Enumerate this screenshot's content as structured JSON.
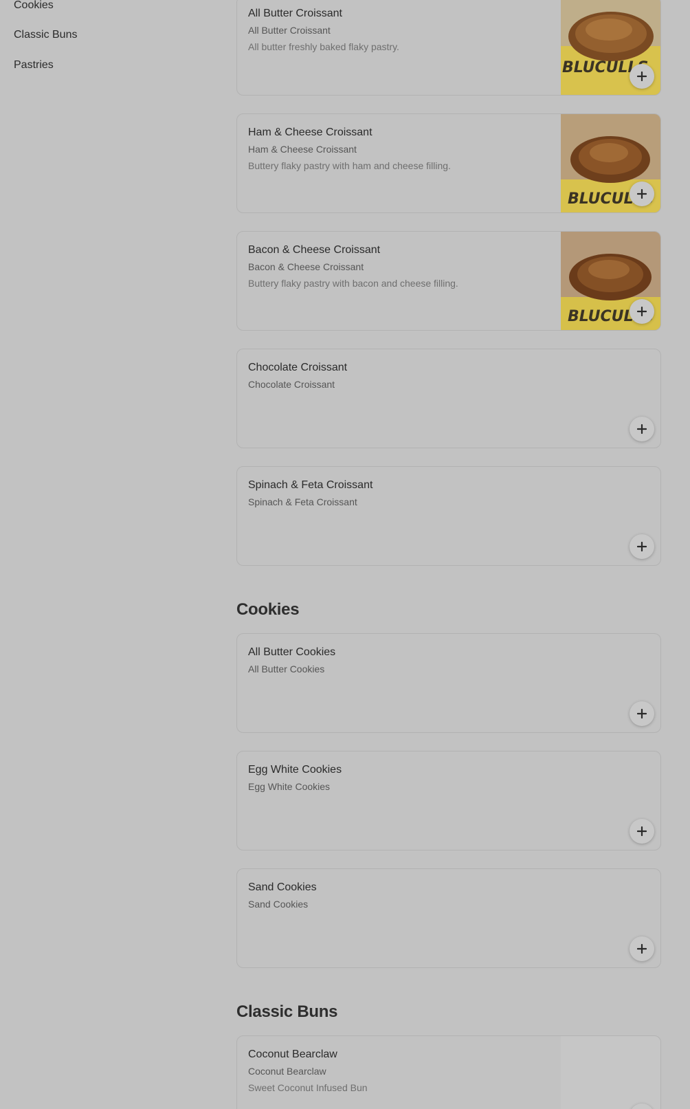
{
  "sidebar": {
    "items": [
      {
        "label": "Cookies"
      },
      {
        "label": "Classic Buns"
      },
      {
        "label": "Pastries"
      }
    ]
  },
  "sections": {
    "cookies": {
      "title": "Cookies"
    },
    "classic_buns": {
      "title": "Classic Buns"
    }
  },
  "items": [
    {
      "title": "All Butter Croissant",
      "subtitle": "All Butter Croissant",
      "description": "All butter freshly baked flaky pastry.",
      "image": "croissant-photo"
    },
    {
      "title": "Ham & Cheese Croissant",
      "subtitle": "Ham & Cheese Croissant",
      "description": "Buttery flaky pastry with ham and cheese filling.",
      "image": "croissant-photo"
    },
    {
      "title": "Bacon & Cheese Croissant",
      "subtitle": "Bacon & Cheese Croissant",
      "description": "Buttery flaky pastry with bacon and cheese filling.",
      "image": "croissant-photo"
    },
    {
      "title": "Chocolate Croissant",
      "subtitle": "Chocolate Croissant"
    },
    {
      "title": "Spinach & Feta Croissant",
      "subtitle": "Spinach & Feta Croissant"
    },
    {
      "title": "All Butter Cookies",
      "subtitle": "All Butter Cookies"
    },
    {
      "title": "Egg White Cookies",
      "subtitle": "Egg White Cookies"
    },
    {
      "title": "Sand Cookies",
      "subtitle": "Sand Cookies"
    },
    {
      "title": "Coconut Bearclaw",
      "subtitle": "Coconut Bearclaw",
      "description": "Sweet Coconut Infused Bun",
      "image": "image-placeholder"
    }
  ],
  "brand_text": "BLUCULLS",
  "colors": {
    "background": "#c2c2c2",
    "card_border": "#b2b2b2",
    "text": "#2b2b2b",
    "plate_yellow": "#d9c24a"
  },
  "icons": {
    "add": "plus-icon"
  }
}
